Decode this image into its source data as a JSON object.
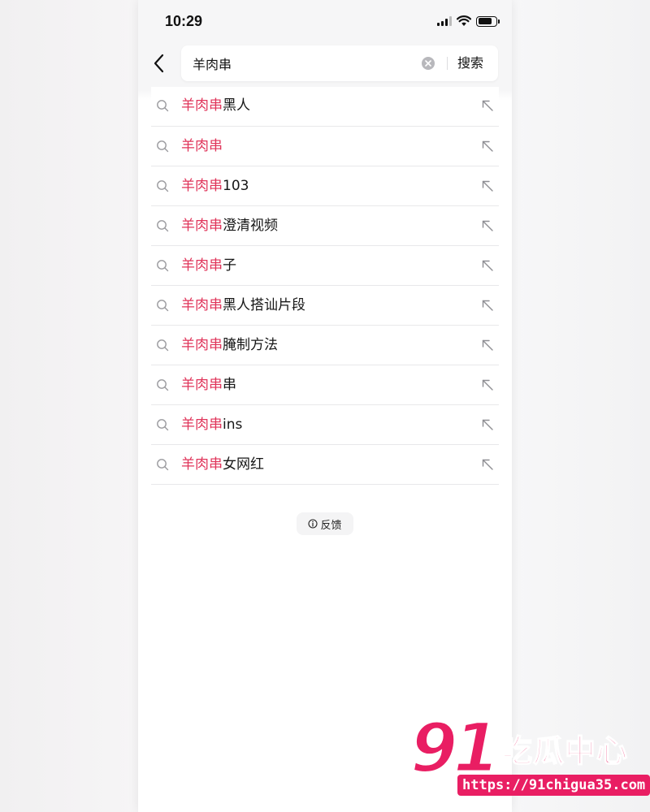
{
  "status_bar": {
    "time": "10:29"
  },
  "search": {
    "query": "羊肉串",
    "submit_label": "搜索"
  },
  "suggestions": [
    {
      "highlight": "羊肉串",
      "rest": "黑人"
    },
    {
      "highlight": "羊肉串",
      "rest": ""
    },
    {
      "highlight": "羊肉串",
      "rest": "103"
    },
    {
      "highlight": "羊肉串",
      "rest": "澄清视频"
    },
    {
      "highlight": "羊肉串",
      "rest": "子"
    },
    {
      "highlight": "羊肉串",
      "rest": "黑人搭讪片段"
    },
    {
      "highlight": "羊肉串",
      "rest": "腌制方法"
    },
    {
      "highlight": "羊肉串",
      "rest": "串"
    },
    {
      "highlight": "羊肉串",
      "rest": "ins"
    },
    {
      "highlight": "羊肉串",
      "rest": "女网红"
    }
  ],
  "feedback": {
    "label": "反馈"
  },
  "watermark": {
    "number": "91",
    "name": "吃瓜中心",
    "url": "https://91chigua35.com"
  },
  "colors": {
    "highlight": "#e0345a",
    "watermark": "#e91e63"
  }
}
